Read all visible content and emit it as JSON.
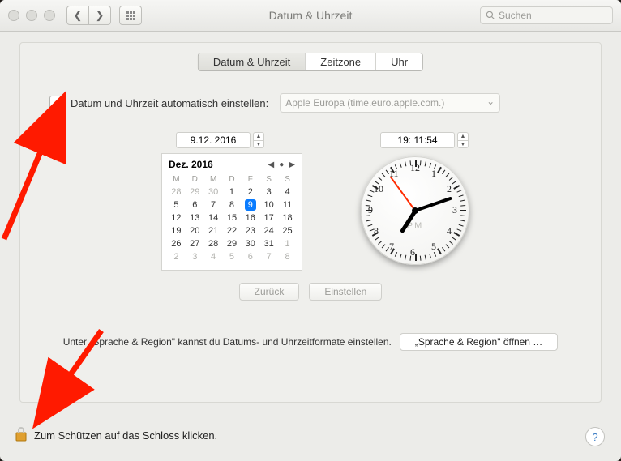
{
  "window": {
    "title": "Datum & Uhrzeit"
  },
  "search": {
    "placeholder": "Suchen"
  },
  "tabs": {
    "date_time": "Datum & Uhrzeit",
    "timezone": "Zeitzone",
    "clock": "Uhr"
  },
  "auto": {
    "label": "Datum und Uhrzeit automatisch einstellen:",
    "server": "Apple Europa (time.euro.apple.com.)"
  },
  "date_field": "9.12. 2016",
  "time_field": "19: 11:54",
  "calendar": {
    "month_label": "Dez. 2016",
    "weekdays": [
      "M",
      "D",
      "M",
      "D",
      "F",
      "S",
      "S"
    ],
    "today": 9,
    "weeks": [
      [
        {
          "d": 28,
          "o": true
        },
        {
          "d": 29,
          "o": true
        },
        {
          "d": 30,
          "o": true
        },
        {
          "d": 1
        },
        {
          "d": 2
        },
        {
          "d": 3
        },
        {
          "d": 4
        }
      ],
      [
        {
          "d": 5
        },
        {
          "d": 6
        },
        {
          "d": 7
        },
        {
          "d": 8
        },
        {
          "d": 9
        },
        {
          "d": 10
        },
        {
          "d": 11
        }
      ],
      [
        {
          "d": 12
        },
        {
          "d": 13
        },
        {
          "d": 14
        },
        {
          "d": 15
        },
        {
          "d": 16
        },
        {
          "d": 17
        },
        {
          "d": 18
        }
      ],
      [
        {
          "d": 19
        },
        {
          "d": 20
        },
        {
          "d": 21
        },
        {
          "d": 22
        },
        {
          "d": 23
        },
        {
          "d": 24
        },
        {
          "d": 25
        }
      ],
      [
        {
          "d": 26
        },
        {
          "d": 27
        },
        {
          "d": 28
        },
        {
          "d": 29
        },
        {
          "d": 30
        },
        {
          "d": 31
        },
        {
          "d": 1,
          "o": true
        }
      ],
      [
        {
          "d": 2,
          "o": true
        },
        {
          "d": 3,
          "o": true
        },
        {
          "d": 4,
          "o": true
        },
        {
          "d": 5,
          "o": true
        },
        {
          "d": 6,
          "o": true
        },
        {
          "d": 7,
          "o": true
        },
        {
          "d": 8,
          "o": true
        }
      ]
    ]
  },
  "clock": {
    "ampm": "PM",
    "numerals": [
      "12",
      "1",
      "2",
      "3",
      "4",
      "5",
      "6",
      "7",
      "8",
      "9",
      "10",
      "11"
    ],
    "hour_angle": 213,
    "minute_angle": 71,
    "second_angle": 324
  },
  "buttons": {
    "revert": "Zurück",
    "save": "Einstellen",
    "open_region": "„Sprache & Region\" öffnen …"
  },
  "footer_note": "Unter „Sprache & Region\" kannst du Datums- und Uhrzeitformate einstellen.",
  "lock": {
    "text": "Zum Schützen auf das Schloss klicken."
  },
  "help": "?"
}
